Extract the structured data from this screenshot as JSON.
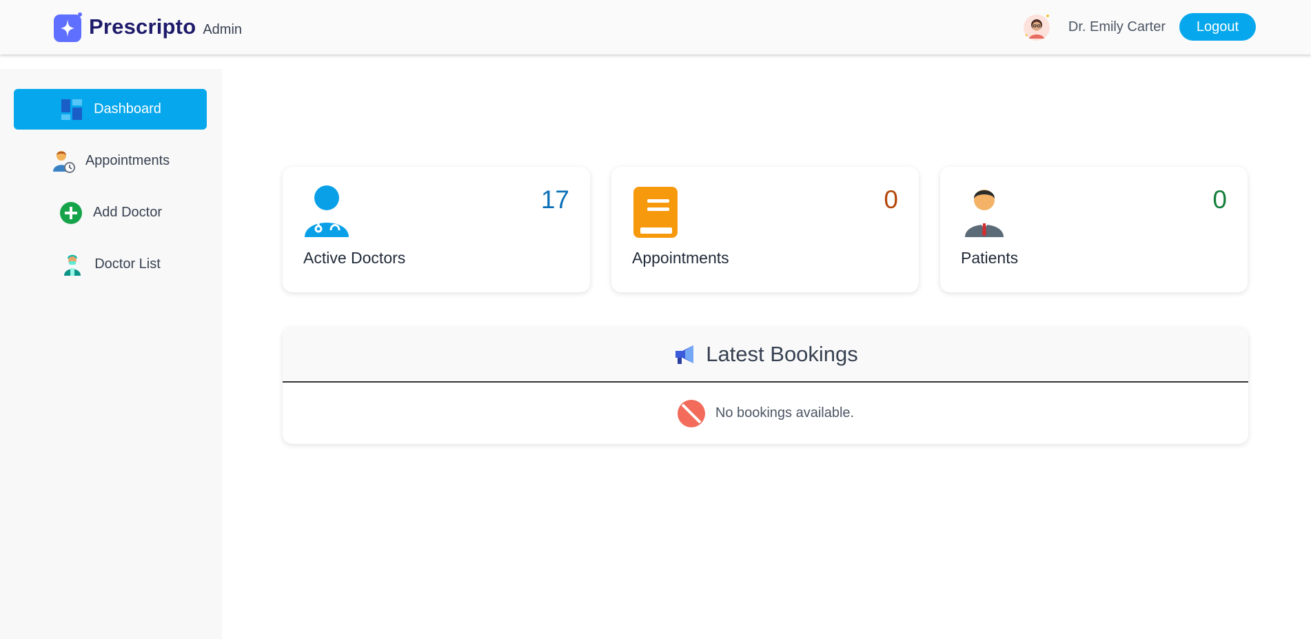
{
  "header": {
    "brand_name": "Prescripto",
    "brand_role": "Admin",
    "user_name": "Dr. Emily Carter",
    "logout_label": "Logout"
  },
  "sidebar": {
    "items": [
      {
        "label": "Dashboard",
        "icon": "dashboard-icon",
        "active": true
      },
      {
        "label": "Appointments",
        "icon": "appointments-icon",
        "active": false
      },
      {
        "label": "Add Doctor",
        "icon": "add-circle-icon",
        "active": false
      },
      {
        "label": "Doctor List",
        "icon": "doctor-icon",
        "active": false
      }
    ]
  },
  "stats": [
    {
      "value": "17",
      "label": "Active Doctors",
      "icon": "doctor-stethoscope-icon",
      "color": "#0b6fb8"
    },
    {
      "value": "0",
      "label": "Appointments",
      "icon": "book-icon",
      "color": "#b4470b"
    },
    {
      "value": "0",
      "label": "Patients",
      "icon": "patient-icon",
      "color": "#15803d"
    }
  ],
  "bookings": {
    "title": "Latest Bookings",
    "empty_text": "No bookings available."
  },
  "colors": {
    "accent": "#06a7ec",
    "brand": "#1e1b6b",
    "logo": "#5f6fff"
  }
}
